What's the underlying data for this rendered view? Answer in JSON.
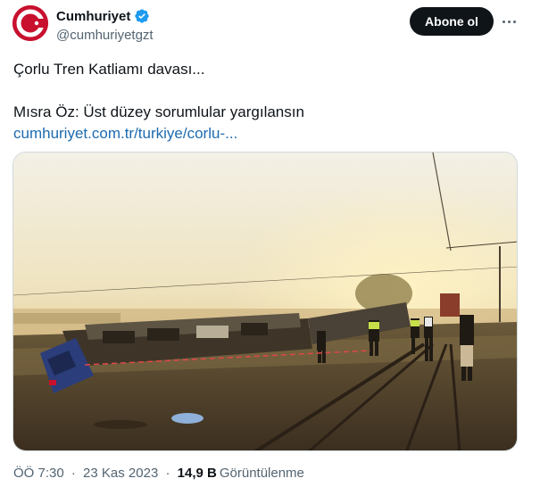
{
  "account": {
    "display_name": "Cumhuriyet",
    "handle": "@cumhuriyetgzt",
    "verified": true,
    "brand_color": "#c8102e",
    "avatar_icon": "cumhuriyet-logo-icon"
  },
  "actions": {
    "follow_label": "Abone ol",
    "more_icon": "more-dots-icon"
  },
  "tweet": {
    "line1": "Çorlu Tren Katliamı davası...",
    "line2": "Mısra Öz: Üst düzey sorumlular yargılansın",
    "link": "cumhuriyet.com.tr/turkiye/corlu-..."
  },
  "media": {
    "type": "photo"
  },
  "meta": {
    "time": "ÖÖ 7:30",
    "date": "23 Kas 2023",
    "separator": "·",
    "views_count": "14,9 B",
    "views_label": "Görüntülenme"
  },
  "colors": {
    "text_primary": "#0f1419",
    "text_secondary": "#536471",
    "link": "#1d6bb0",
    "verified_badge": "#1d9bf0"
  }
}
